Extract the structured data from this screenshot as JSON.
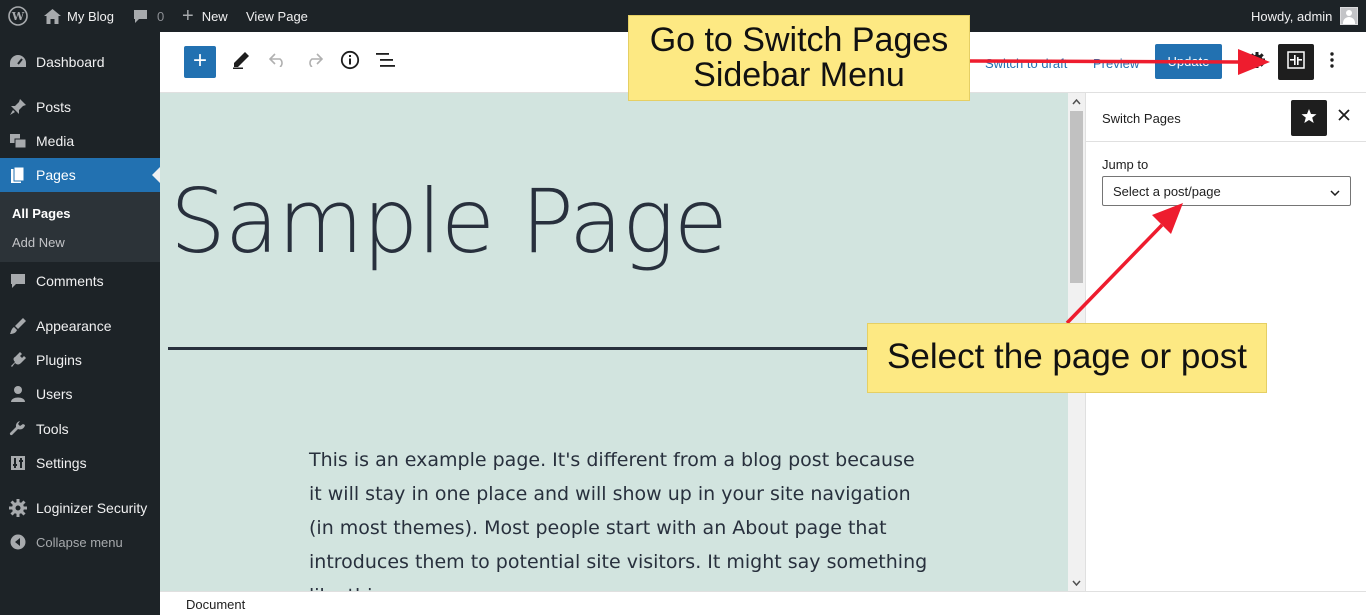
{
  "admin_bar": {
    "site_name": "My Blog",
    "comments_count": "0",
    "new_label": "New",
    "view_page_label": "View Page",
    "greeting": "Howdy, admin"
  },
  "admin_menu": {
    "items": [
      {
        "label": "Dashboard",
        "icon": "dashboard-icon"
      },
      {
        "label": "Posts",
        "icon": "pin-icon"
      },
      {
        "label": "Media",
        "icon": "media-icon"
      },
      {
        "label": "Pages",
        "icon": "pages-icon"
      },
      {
        "label": "Comments",
        "icon": "comment-icon"
      },
      {
        "label": "Appearance",
        "icon": "brush-icon"
      },
      {
        "label": "Plugins",
        "icon": "plug-icon"
      },
      {
        "label": "Users",
        "icon": "user-icon"
      },
      {
        "label": "Tools",
        "icon": "wrench-icon"
      },
      {
        "label": "Settings",
        "icon": "settings-icon"
      },
      {
        "label": "Loginizer Security",
        "icon": "gear-icon"
      }
    ],
    "submenu": {
      "all_pages": "All Pages",
      "add_new": "Add New"
    },
    "collapse_label": "Collapse menu",
    "accent_color": "#2271b1"
  },
  "editor_header": {
    "switch_to_draft": "Switch to draft",
    "preview": "Preview",
    "update": "Update"
  },
  "canvas": {
    "title": "Sample Page",
    "paragraph": "This is an example page. It's different from a blog post because it will stay in one place and will show up in your site navigation (in most themes). Most people start with an About page that introduces them to potential site visitors. It might say something like this:",
    "background_color": "#d2e4df"
  },
  "sidebar": {
    "title": "Switch Pages",
    "jump_to_label": "Jump to",
    "select_value": "Select a post/page"
  },
  "footer": {
    "breadcrumb": "Document"
  },
  "annotations": {
    "callout_1": [
      "Go to Switch Pages",
      "Sidebar Menu"
    ],
    "callout_2": "Select the page or post",
    "callout_color": "#fde983",
    "arrow_color": "#ee1c2e"
  }
}
